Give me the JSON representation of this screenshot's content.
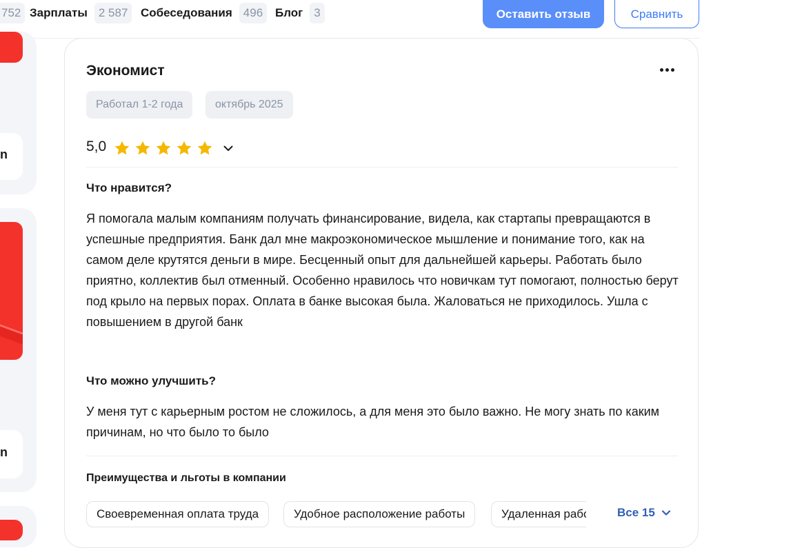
{
  "nav": {
    "partial_count": "752",
    "items": [
      {
        "label": "Зарплаты",
        "count": "2 587"
      },
      {
        "label": "Собеседования",
        "count": "496"
      },
      {
        "label": "Блог",
        "count": "3"
      }
    ],
    "leave_review": "Оставить отзыв",
    "compare": "Сравнить"
  },
  "left": {
    "frag1": "n",
    "frag2": "n"
  },
  "review": {
    "title": "Экономист",
    "tags": [
      "Работал 1-2 года",
      "октябрь 2025"
    ],
    "rating": "5,0",
    "stars": 5,
    "likes_heading": "Что нравится?",
    "likes_text": "Я помогала малым компаниям получать финансирование, видела, как стартапы превращаются в успешные предприятия. Банк дал мне макроэкономическое мышление и понимание того, как на самом деле крутятся деньги в мире. Бесценный опыт для дальнейшей карьеры. Работать было приятно, коллектив был отменный. Особенно нравилось что новичкам тут помогают, полностью берут под крыло на первых порах. Оплата в банке высокая была. Жаловаться не приходилось. Ушла с повышением в другой банк",
    "improve_heading": "Что можно улучшить?",
    "improve_text": "У меня тут с карьерным ростом не сложилось, а для меня это было важно. Не могу знать по каким причинам, но что было то было",
    "benefits_heading": "Преимущества и льготы в компании",
    "benefits": [
      "Своевременная оплата труда",
      "Удобное расположение работы",
      "Удаленная работа"
    ],
    "all_benefits": "Все 15"
  },
  "colors": {
    "accent": "#5a8ef8",
    "star": "#f5b800",
    "brand_red": "#f3322b",
    "link": "#2f5fb5"
  }
}
